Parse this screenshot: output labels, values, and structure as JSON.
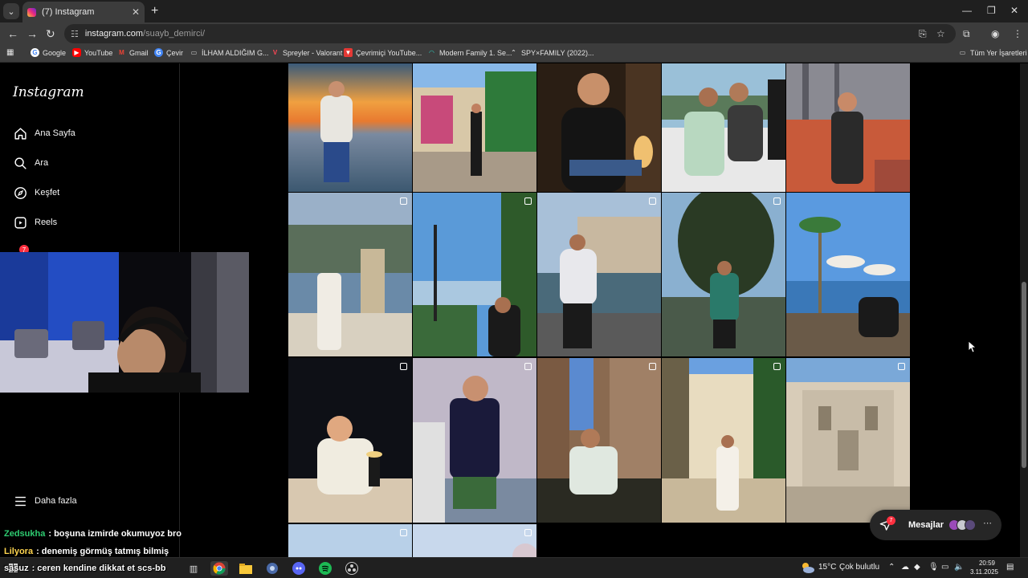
{
  "browser": {
    "tab_title": "(7) Instagram",
    "url_host": "instagram.com",
    "url_path": "/suayb_demirci/",
    "bookmarks": [
      {
        "label": "Google",
        "icon": "google-icon",
        "color": "#4285f4"
      },
      {
        "label": "YouTube",
        "icon": "youtube-icon",
        "color": "#ff0000"
      },
      {
        "label": "Gmail",
        "icon": "gmail-icon",
        "color": "#ea4335"
      },
      {
        "label": "Çevir",
        "icon": "translate-icon",
        "color": "#4285f4"
      },
      {
        "label": "İLHAM ALDIĞIM G...",
        "icon": "folder-icon",
        "color": "#cccccc"
      },
      {
        "label": "Spreyler - Valorant",
        "icon": "valorant-icon",
        "color": "#ff4655"
      },
      {
        "label": "Çevrimiçi YouTube...",
        "icon": "tool-icon",
        "color": "#e53935"
      },
      {
        "label": "Modern Family 1. Se...",
        "icon": "stream-icon",
        "color": "#2ec4b6"
      },
      {
        "label": "SPY×FAMILY (2022)...",
        "icon": "stream-icon",
        "color": "#dddddd"
      }
    ],
    "all_bookmarks": "Tüm Yer İşaretleri"
  },
  "instagram": {
    "logo": "Instagram",
    "nav": [
      {
        "label": "Ana Sayfa",
        "icon": "home-icon"
      },
      {
        "label": "Ara",
        "icon": "search-icon"
      },
      {
        "label": "Keşfet",
        "icon": "explore-icon"
      },
      {
        "label": "Reels",
        "icon": "reels-icon"
      }
    ],
    "notification_count": "7",
    "more_label": "Daha fazla",
    "messages": {
      "label": "Mesajlar",
      "count": "7"
    }
  },
  "chat": [
    {
      "user": "Zedsukha",
      "text": ": boşuna izmirde okumuyoz bro",
      "color": "#2ecc71"
    },
    {
      "user": "Lilyora",
      "text": ": denemiş görmüş tatmış bilmiş",
      "color": "#ffd54f"
    },
    {
      "user": "sasuz",
      "text": ": ceren kendine dikkat et scs-bb",
      "color": "#ffffff"
    }
  ],
  "taskbar": {
    "weather": "15°C",
    "weather_desc": "Çok bulutlu",
    "time": "20:59",
    "date": "3.11.2025"
  },
  "colors": {
    "chrome_bg": "#3c3c3c",
    "ig_bg": "#000000",
    "notification_red": "#ff3040"
  }
}
